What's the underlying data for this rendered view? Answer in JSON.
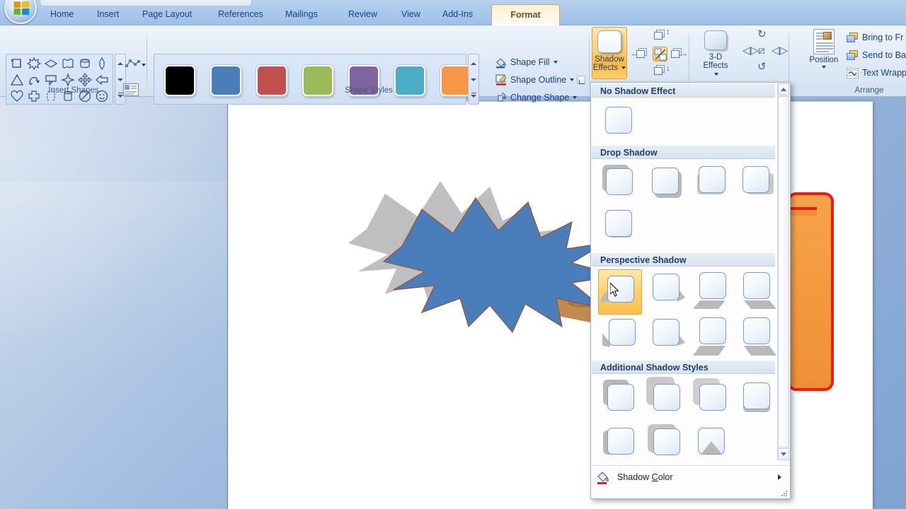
{
  "app": {
    "orb_icon": "office-orb-icon"
  },
  "tabs": [
    {
      "label": "Home",
      "active": false
    },
    {
      "label": "Insert",
      "active": false
    },
    {
      "label": "Page Layout",
      "active": false
    },
    {
      "label": "References",
      "active": false
    },
    {
      "label": "Mailings",
      "active": false
    },
    {
      "label": "Review",
      "active": false
    },
    {
      "label": "View",
      "active": false
    },
    {
      "label": "Add-Ins",
      "active": false
    },
    {
      "label": "Format",
      "active": true
    }
  ],
  "groups": {
    "insert_shapes": {
      "label": "Insert Shapes",
      "shapes": [
        "scroll-shape-icon",
        "explosion-shape-icon",
        "diamond-shape-icon",
        "wave-shape-icon",
        "cylinder-shape-icon",
        "decagon-shape-icon",
        "triangle-shape-icon",
        "curved-arrow-icon",
        "callout-shape-icon",
        "four-point-star-icon",
        "four-way-arrow-icon",
        "left-arrow-icon",
        "heart-shape-icon",
        "cross-shape-icon",
        "bracket-pair-icon",
        "can-shape-icon",
        "no-symbol-icon",
        "smiley-face-icon"
      ],
      "edit_points_label": "edit-shape-icon",
      "text_box_label": "draw-text-box-icon"
    },
    "shape_styles": {
      "label": "Shape Styles",
      "swatches": [
        "#000000",
        "#4a7ebb",
        "#c0504d",
        "#9bbb59",
        "#8064a2",
        "#4bacc6",
        "#f79646"
      ],
      "commands": [
        {
          "label": "Shape Fill",
          "icon": "paint-bucket-icon",
          "has_caret": true
        },
        {
          "label": "Shape Outline",
          "icon": "pencil-outline-icon",
          "has_caret": true
        },
        {
          "label": "Change Shape",
          "icon": "change-shape-icon",
          "has_caret": true
        }
      ],
      "dialog_launcher": "shape-styles-dialog-launcher"
    },
    "shadow_effects": {
      "button_label_line1": "Shadow",
      "button_label_line2": "Effects",
      "nudge_icon": "nudge-shadow-icon"
    },
    "three_d_effects": {
      "button_label_line1": "3-D",
      "button_label_line2": "Effects",
      "rotate_icons": [
        "tilt-up-icon",
        "tilt-left-icon",
        "perspective-icon",
        "tilt-right-icon",
        "tilt-down-icon"
      ]
    },
    "arrange": {
      "label": "Arrange",
      "position_label": "Position",
      "items": [
        {
          "label": "Bring to Fr",
          "icon": "bring-to-front-icon"
        },
        {
          "label": "Send to Ba",
          "icon": "send-to-back-icon"
        },
        {
          "label": "Text Wrapp",
          "icon": "text-wrapping-icon"
        }
      ]
    }
  },
  "gallery": {
    "sections": [
      {
        "title": "No Shadow Effect",
        "items": [
          {
            "name": "no-shadow",
            "shadow": "none",
            "selected": false
          }
        ]
      },
      {
        "title": "Drop Shadow",
        "items": [
          {
            "name": "drop-shadow-1",
            "shadow": "left-up",
            "selected": false
          },
          {
            "name": "drop-shadow-2",
            "shadow": "right-down",
            "selected": false
          },
          {
            "name": "drop-shadow-3",
            "shadow": "down-left",
            "selected": false
          },
          {
            "name": "drop-shadow-4",
            "shadow": "down-right",
            "selected": false
          },
          {
            "name": "drop-shadow-5",
            "shadow": "right-down-small",
            "selected": false
          }
        ]
      },
      {
        "title": "Perspective Shadow",
        "items": [
          {
            "name": "perspective-shadow-1",
            "shadow": "persp-left",
            "selected": true
          },
          {
            "name": "perspective-shadow-2",
            "shadow": "persp-right",
            "selected": false
          },
          {
            "name": "perspective-shadow-3",
            "shadow": "persp-bottom-left",
            "selected": false
          },
          {
            "name": "perspective-shadow-4",
            "shadow": "persp-bottom-right",
            "selected": false
          },
          {
            "name": "perspective-shadow-5",
            "shadow": "persp-left-2",
            "selected": false
          },
          {
            "name": "perspective-shadow-6",
            "shadow": "persp-right-2",
            "selected": false
          },
          {
            "name": "perspective-shadow-7",
            "shadow": "persp-bottom-left-2",
            "selected": false
          },
          {
            "name": "perspective-shadow-8",
            "shadow": "persp-bottom-right-2",
            "selected": false
          }
        ]
      },
      {
        "title": "Additional Shadow Styles",
        "items": [
          {
            "name": "additional-shadow-1",
            "shadow": "offset-up-left",
            "selected": false
          },
          {
            "name": "additional-shadow-2",
            "shadow": "offset-up-left-large",
            "selected": false
          },
          {
            "name": "additional-shadow-3",
            "shadow": "offset-up-left-soft",
            "selected": false
          },
          {
            "name": "additional-shadow-4",
            "shadow": "offset-down",
            "selected": false
          },
          {
            "name": "additional-shadow-5",
            "shadow": "offset-down-left",
            "selected": false
          },
          {
            "name": "additional-shadow-6",
            "shadow": "offset-left",
            "selected": false
          },
          {
            "name": "additional-shadow-7",
            "shadow": "inner-bottom",
            "selected": false
          }
        ]
      }
    ],
    "footer": {
      "label_pre": "Shadow ",
      "label_accel": "C",
      "label_post": "olor",
      "icon": "shadow-color-icon",
      "submenu_arrow": "submenu-arrow-icon"
    },
    "scrollbar": {
      "up_icon": "scroll-up-icon",
      "down_icon": "scroll-down-icon"
    }
  },
  "canvas": {
    "shapes": [
      {
        "name": "explosion-burst-shape",
        "fill": "#4a7ebb",
        "outline": "#9c4d32"
      },
      {
        "name": "explosion-burst-shadow",
        "fill": "#bfbfbf"
      },
      {
        "name": "orange-rounded-shape",
        "fill": "#ef9036",
        "outline": "#ee1c16"
      },
      {
        "name": "brown-arrow-shape",
        "fill": "#c08a52"
      }
    ]
  },
  "colors": {
    "ribbon_accent": "#c0d6ef",
    "tab_active": "#fdf5e3",
    "selection_highlight": "#fbbf4a",
    "desktop": "#8fafd8"
  }
}
